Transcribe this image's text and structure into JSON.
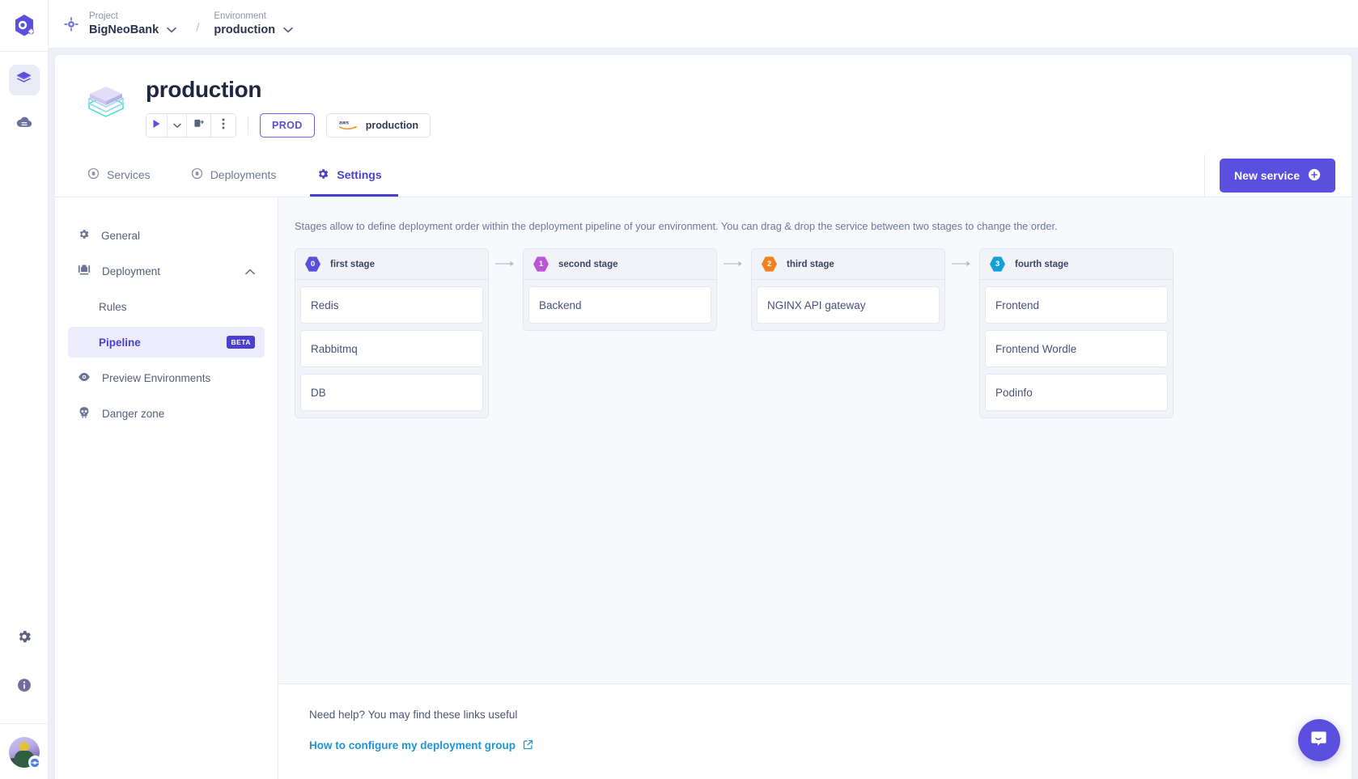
{
  "rail": {
    "logo_icon": "qovery-logo-icon",
    "items": [
      {
        "icon": "layers-icon",
        "name": "rail-item-environments",
        "active": true
      },
      {
        "icon": "cloud-server-icon",
        "name": "rail-item-infrastructure",
        "active": false
      }
    ],
    "bottom_items": [
      {
        "icon": "gear-icon",
        "name": "rail-item-settings"
      },
      {
        "icon": "info-icon",
        "name": "rail-item-help"
      }
    ],
    "avatar_name": "user-avatar"
  },
  "breadcrumb": {
    "project_label": "Project",
    "project_value": "BigNeoBank",
    "separator": "/",
    "environment_label": "Environment",
    "environment_value": "production"
  },
  "env_header": {
    "title": "production",
    "play_icon": "play-icon",
    "caret_icon": "chevron-down-icon",
    "redeploy_icon": "redeploy-icon",
    "more_icon": "more-vertical-icon",
    "prod_badge": "PROD",
    "cloud_provider": "aws",
    "cloud_cluster": "production"
  },
  "tabs": [
    {
      "label": "Services",
      "icon": "services-icon",
      "active": false
    },
    {
      "label": "Deployments",
      "icon": "deployments-icon",
      "active": false
    },
    {
      "label": "Settings",
      "icon": "gear-icon",
      "active": true
    }
  ],
  "new_service": {
    "label": "New service",
    "icon": "plus-circle-icon"
  },
  "settings_nav": [
    {
      "label": "General",
      "icon": "gear-icon",
      "level": "top",
      "selected": false,
      "badge": null
    },
    {
      "label": "Deployment",
      "icon": "deployment-icon",
      "level": "top",
      "selected": false,
      "badge": null,
      "chevron": "chevron-up-icon"
    },
    {
      "label": "Rules",
      "icon": null,
      "level": "sub",
      "selected": false,
      "badge": null
    },
    {
      "label": "Pipeline",
      "icon": null,
      "level": "sub",
      "selected": true,
      "badge": "BETA"
    },
    {
      "label": "Preview Environments",
      "icon": "eye-icon",
      "level": "top",
      "selected": false,
      "badge": null
    },
    {
      "label": "Danger zone",
      "icon": "skull-icon",
      "level": "top",
      "selected": false,
      "badge": null
    }
  ],
  "pipeline": {
    "description": "Stages allow to define deployment order within the deployment pipeline of your environment. You can drag & drop the service between two stages to change the order.",
    "stages": [
      {
        "index": "0",
        "name": "first stage",
        "color": "#5b4fd8",
        "services": [
          "Redis",
          "Rabbitmq",
          "DB"
        ]
      },
      {
        "index": "1",
        "name": "second stage",
        "color": "#bc54d8",
        "services": [
          "Backend"
        ]
      },
      {
        "index": "2",
        "name": "third stage",
        "color": "#f0821e",
        "services": [
          "NGINX API gateway"
        ]
      },
      {
        "index": "3",
        "name": "fourth stage",
        "color": "#12a0d7",
        "services": [
          "Frontend",
          "Frontend Wordle",
          "Podinfo"
        ]
      }
    ]
  },
  "help": {
    "title": "Need help? You may find these links useful",
    "link_label": "How to configure my deployment group",
    "link_icon": "external-link-icon"
  },
  "chat": {
    "icon": "chat-bubble-icon"
  },
  "colors": {
    "accent": "#5b4fe0",
    "accent_text": "#4b3fd0",
    "link": "#1f95d6",
    "page_bg": "#eceff6",
    "pipeline_bg": "#f8f9fc"
  }
}
